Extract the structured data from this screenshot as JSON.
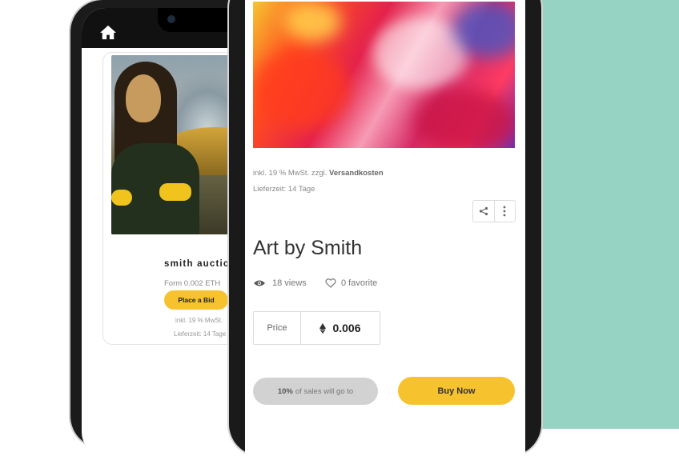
{
  "back_phone": {
    "card": {
      "title": "smith auctio",
      "from": "Form 0.002 ETH",
      "bid_button": "Place a Bid",
      "vat": "inkl. 19 % MwSt.",
      "delivery": "Lieferzeit: 14 Tage"
    }
  },
  "front_phone": {
    "vat_prefix": "inkl. 19 % MwSt. zzgl.",
    "vat_link": "Versandkosten",
    "delivery": "Lieferzeit: 14 Tage",
    "title": "Art by Smith",
    "views": "18 views",
    "favorites": "0 favorite",
    "price_label": "Price",
    "price_value": "0.006",
    "sales_pct": "10%",
    "sales_text": "of sales will go to",
    "buy_button": "Buy Now"
  },
  "colors": {
    "accent_yellow": "#f6c22e",
    "teal_background": "#97d3c2"
  },
  "icons": [
    "home-icon",
    "share-icon",
    "more-vertical-icon",
    "eye-icon",
    "heart-icon",
    "ethereum-icon"
  ]
}
